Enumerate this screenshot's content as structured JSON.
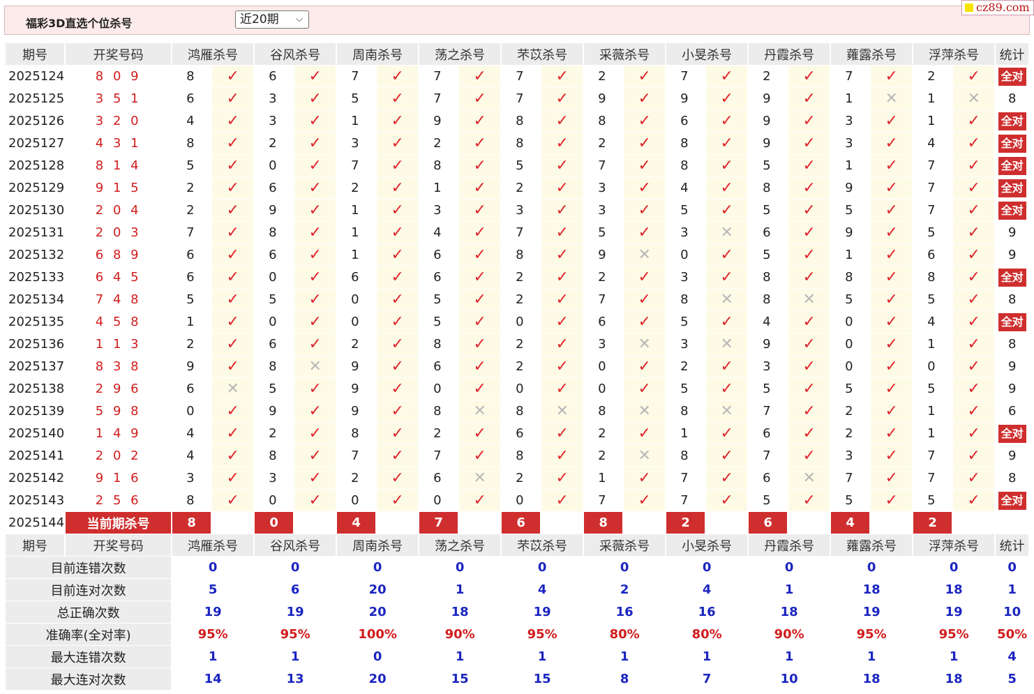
{
  "header": {
    "title": "福彩3D直选个位杀号",
    "period_selected": "近20期",
    "brand": "cz89.com"
  },
  "columns": {
    "issue": "期号",
    "draw": "开奖号码",
    "experts": [
      "鸿雁杀号",
      "谷风杀号",
      "周南杀号",
      "荡之杀号",
      "芣苡杀号",
      "采薇杀号",
      "小旻杀号",
      "丹霞杀号",
      "蕹露杀号",
      "浮萍杀号"
    ],
    "stat": "统计"
  },
  "all_correct_label": "全对",
  "rows": [
    {
      "issue": "2025124",
      "draw": "8 0 9",
      "kills": [
        8,
        6,
        7,
        7,
        7,
        2,
        7,
        2,
        7,
        2
      ],
      "hits": [
        1,
        1,
        1,
        1,
        1,
        1,
        1,
        1,
        1,
        1
      ],
      "stat": "全对"
    },
    {
      "issue": "2025125",
      "draw": "3 5 1",
      "kills": [
        6,
        3,
        5,
        7,
        7,
        9,
        9,
        9,
        1,
        1
      ],
      "hits": [
        1,
        1,
        1,
        1,
        1,
        1,
        1,
        1,
        0,
        0
      ],
      "stat": "8"
    },
    {
      "issue": "2025126",
      "draw": "3 2 0",
      "kills": [
        4,
        3,
        1,
        9,
        8,
        8,
        6,
        9,
        3,
        1
      ],
      "hits": [
        1,
        1,
        1,
        1,
        1,
        1,
        1,
        1,
        1,
        1
      ],
      "stat": "全对"
    },
    {
      "issue": "2025127",
      "draw": "4 3 1",
      "kills": [
        8,
        2,
        3,
        2,
        8,
        2,
        8,
        9,
        3,
        4
      ],
      "hits": [
        1,
        1,
        1,
        1,
        1,
        1,
        1,
        1,
        1,
        1
      ],
      "stat": "全对"
    },
    {
      "issue": "2025128",
      "draw": "8 1 4",
      "kills": [
        5,
        0,
        7,
        8,
        5,
        7,
        8,
        5,
        1,
        7
      ],
      "hits": [
        1,
        1,
        1,
        1,
        1,
        1,
        1,
        1,
        1,
        1
      ],
      "stat": "全对"
    },
    {
      "issue": "2025129",
      "draw": "9 1 5",
      "kills": [
        2,
        6,
        2,
        1,
        2,
        3,
        4,
        8,
        9,
        7
      ],
      "hits": [
        1,
        1,
        1,
        1,
        1,
        1,
        1,
        1,
        1,
        1
      ],
      "stat": "全对"
    },
    {
      "issue": "2025130",
      "draw": "2 0 4",
      "kills": [
        2,
        9,
        1,
        3,
        3,
        3,
        5,
        5,
        5,
        7
      ],
      "hits": [
        1,
        1,
        1,
        1,
        1,
        1,
        1,
        1,
        1,
        1
      ],
      "stat": "全对"
    },
    {
      "issue": "2025131",
      "draw": "2 0 3",
      "kills": [
        7,
        8,
        1,
        4,
        7,
        5,
        3,
        6,
        9,
        5
      ],
      "hits": [
        1,
        1,
        1,
        1,
        1,
        1,
        0,
        1,
        1,
        1
      ],
      "stat": "9"
    },
    {
      "issue": "2025132",
      "draw": "6 8 9",
      "kills": [
        6,
        6,
        1,
        6,
        8,
        9,
        0,
        5,
        1,
        6
      ],
      "hits": [
        1,
        1,
        1,
        1,
        1,
        0,
        1,
        1,
        1,
        1
      ],
      "stat": "9"
    },
    {
      "issue": "2025133",
      "draw": "6 4 5",
      "kills": [
        6,
        0,
        6,
        6,
        2,
        2,
        3,
        8,
        8,
        8
      ],
      "hits": [
        1,
        1,
        1,
        1,
        1,
        1,
        1,
        1,
        1,
        1
      ],
      "stat": "全对"
    },
    {
      "issue": "2025134",
      "draw": "7 4 8",
      "kills": [
        5,
        5,
        0,
        5,
        2,
        7,
        8,
        8,
        5,
        5
      ],
      "hits": [
        1,
        1,
        1,
        1,
        1,
        1,
        0,
        0,
        1,
        1
      ],
      "stat": "8"
    },
    {
      "issue": "2025135",
      "draw": "4 5 8",
      "kills": [
        1,
        0,
        0,
        5,
        0,
        6,
        5,
        4,
        0,
        4
      ],
      "hits": [
        1,
        1,
        1,
        1,
        1,
        1,
        1,
        1,
        1,
        1
      ],
      "stat": "全对"
    },
    {
      "issue": "2025136",
      "draw": "1 1 3",
      "kills": [
        2,
        6,
        2,
        8,
        2,
        3,
        3,
        9,
        0,
        1
      ],
      "hits": [
        1,
        1,
        1,
        1,
        1,
        0,
        0,
        1,
        1,
        1
      ],
      "stat": "8"
    },
    {
      "issue": "2025137",
      "draw": "8 3 8",
      "kills": [
        9,
        8,
        9,
        6,
        2,
        0,
        2,
        3,
        0,
        0
      ],
      "hits": [
        1,
        0,
        1,
        1,
        1,
        1,
        1,
        1,
        1,
        1
      ],
      "stat": "9"
    },
    {
      "issue": "2025138",
      "draw": "2 9 6",
      "kills": [
        6,
        5,
        9,
        0,
        0,
        0,
        5,
        5,
        5,
        5
      ],
      "hits": [
        0,
        1,
        1,
        1,
        1,
        1,
        1,
        1,
        1,
        1
      ],
      "stat": "9"
    },
    {
      "issue": "2025139",
      "draw": "5 9 8",
      "kills": [
        0,
        9,
        9,
        8,
        8,
        8,
        8,
        7,
        2,
        1
      ],
      "hits": [
        1,
        1,
        1,
        0,
        0,
        0,
        0,
        1,
        1,
        1
      ],
      "stat": "6"
    },
    {
      "issue": "2025140",
      "draw": "1 4 9",
      "kills": [
        4,
        2,
        8,
        2,
        6,
        2,
        1,
        6,
        2,
        1
      ],
      "hits": [
        1,
        1,
        1,
        1,
        1,
        1,
        1,
        1,
        1,
        1
      ],
      "stat": "全对"
    },
    {
      "issue": "2025141",
      "draw": "2 0 2",
      "kills": [
        4,
        8,
        7,
        7,
        8,
        2,
        8,
        7,
        3,
        7
      ],
      "hits": [
        1,
        1,
        1,
        1,
        1,
        0,
        1,
        1,
        1,
        1
      ],
      "stat": "9"
    },
    {
      "issue": "2025142",
      "draw": "9 1 6",
      "kills": [
        3,
        3,
        2,
        6,
        2,
        1,
        7,
        6,
        7,
        7
      ],
      "hits": [
        1,
        1,
        1,
        0,
        1,
        1,
        1,
        0,
        1,
        1
      ],
      "stat": "8"
    },
    {
      "issue": "2025143",
      "draw": "2 5 6",
      "kills": [
        8,
        0,
        0,
        0,
        0,
        7,
        7,
        5,
        5,
        5
      ],
      "hits": [
        1,
        1,
        1,
        1,
        1,
        1,
        1,
        1,
        1,
        1
      ],
      "stat": "全对"
    }
  ],
  "current": {
    "issue": "2025144",
    "label": "当前期杀号",
    "kills": [
      8,
      0,
      4,
      7,
      6,
      8,
      2,
      6,
      4,
      2
    ]
  },
  "summary": [
    {
      "label": "目前连错次数",
      "values": [
        "0",
        "0",
        "0",
        "0",
        "0",
        "0",
        "0",
        "0",
        "0",
        "0"
      ],
      "stat": "0",
      "color": "blue"
    },
    {
      "label": "目前连对次数",
      "values": [
        "5",
        "6",
        "20",
        "1",
        "4",
        "2",
        "4",
        "1",
        "18",
        "18"
      ],
      "stat": "1",
      "color": "blue"
    },
    {
      "label": "总正确次数",
      "values": [
        "19",
        "19",
        "20",
        "18",
        "19",
        "16",
        "16",
        "18",
        "19",
        "19"
      ],
      "stat": "10",
      "color": "blue"
    },
    {
      "label": "准确率(全对率)",
      "values": [
        "95%",
        "95%",
        "100%",
        "90%",
        "95%",
        "80%",
        "80%",
        "90%",
        "95%",
        "95%"
      ],
      "stat": "50%",
      "color": "red"
    },
    {
      "label": "最大连错次数",
      "values": [
        "1",
        "1",
        "0",
        "1",
        "1",
        "1",
        "1",
        "1",
        "1",
        "1"
      ],
      "stat": "4",
      "color": "blue"
    },
    {
      "label": "最大连对次数",
      "values": [
        "14",
        "13",
        "20",
        "15",
        "15",
        "8",
        "7",
        "10",
        "18",
        "18"
      ],
      "stat": "5",
      "color": "blue"
    }
  ],
  "colors": {
    "accent": "#cf2e2e",
    "hit": "#e0242b",
    "miss": "#b8b8b8",
    "summary_blue": "#1b25c0",
    "summary_red": "#d21c1c"
  }
}
